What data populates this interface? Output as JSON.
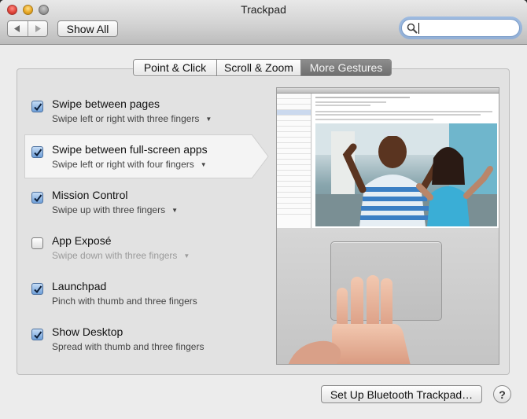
{
  "window": {
    "title": "Trackpad"
  },
  "toolbar": {
    "back_icon": "back-arrow-icon",
    "forward_icon": "forward-arrow-icon",
    "show_all_label": "Show All",
    "search_placeholder": "",
    "search_value": ""
  },
  "tabs": [
    {
      "label": "Point & Click",
      "active": false
    },
    {
      "label": "Scroll & Zoom",
      "active": false
    },
    {
      "label": "More Gestures",
      "active": true
    }
  ],
  "gestures": [
    {
      "title": "Swipe between pages",
      "subtitle": "Swipe left or right with three fingers",
      "checked": true,
      "has_menu": true,
      "enabled": true
    },
    {
      "title": "Swipe between full-screen apps",
      "subtitle": "Swipe left or right with four fingers",
      "checked": true,
      "has_menu": true,
      "enabled": true,
      "selected": true
    },
    {
      "title": "Mission Control",
      "subtitle": "Swipe up with three fingers",
      "checked": true,
      "has_menu": true,
      "enabled": true
    },
    {
      "title": "App Exposé",
      "subtitle": "Swipe down with three fingers",
      "checked": false,
      "has_menu": true,
      "enabled": false
    },
    {
      "title": "Launchpad",
      "subtitle": "Pinch with thumb and three fingers",
      "checked": true,
      "has_menu": false,
      "enabled": true
    },
    {
      "title": "Show Desktop",
      "subtitle": "Spread with thumb and three fingers",
      "checked": true,
      "has_menu": false,
      "enabled": true
    }
  ],
  "footer": {
    "bluetooth_button_label": "Set Up Bluetooth Trackpad…",
    "help_label": "?"
  },
  "colors": {
    "active_tab": "#7d7d7d",
    "checkbox_checked": "#6e9fd8",
    "search_focus_ring": "#6ca0e6"
  }
}
